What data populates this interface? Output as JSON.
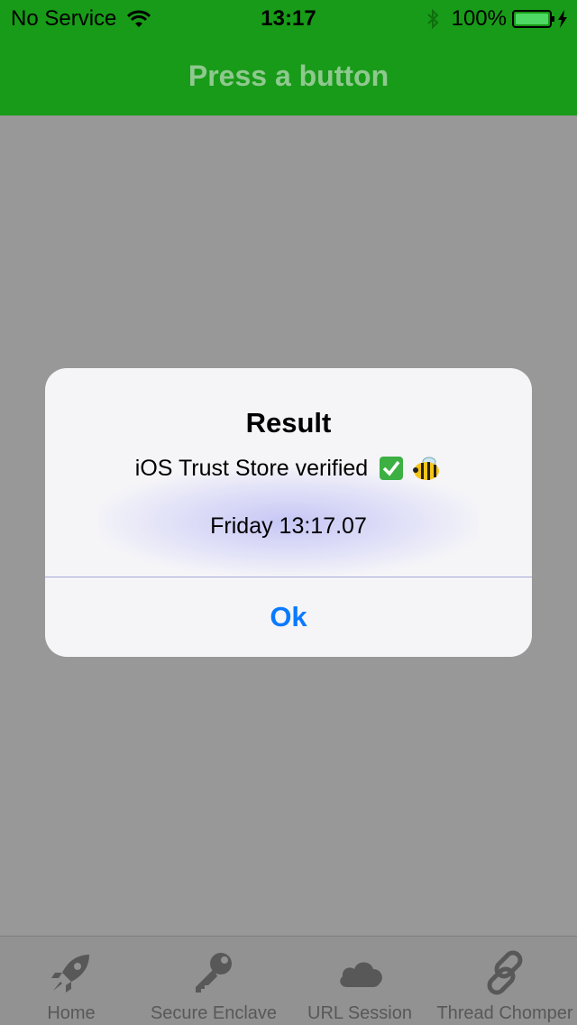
{
  "status_bar": {
    "carrier": "No Service",
    "time": "13:17",
    "battery": "100%",
    "wifi_icon": "wifi-icon",
    "bluetooth_icon": "bluetooth-icon",
    "battery_icon": "battery-icon",
    "charging_icon": "bolt-icon"
  },
  "nav_bar": {
    "title": "Press a button"
  },
  "alert": {
    "title": "Result",
    "message": "iOS Trust Store verified",
    "message_icons": [
      "check-icon",
      "bee-icon"
    ],
    "time": "Friday 13:17.07",
    "ok_label": "Ok"
  },
  "tab_bar": {
    "items": [
      {
        "label": "Home",
        "icon": "rocket-icon"
      },
      {
        "label": "Secure Enclave",
        "icon": "key-icon"
      },
      {
        "label": "URL Session",
        "icon": "cloud-icon"
      },
      {
        "label": "Thread Chomper",
        "icon": "link-icon"
      }
    ]
  },
  "colors": {
    "nav_green": "#189b18",
    "nav_title": "#8fc98f",
    "dim_background": "#989898",
    "alert_button": "#0a7aff",
    "tab_bar": "#929292",
    "tab_icon": "#585858"
  }
}
